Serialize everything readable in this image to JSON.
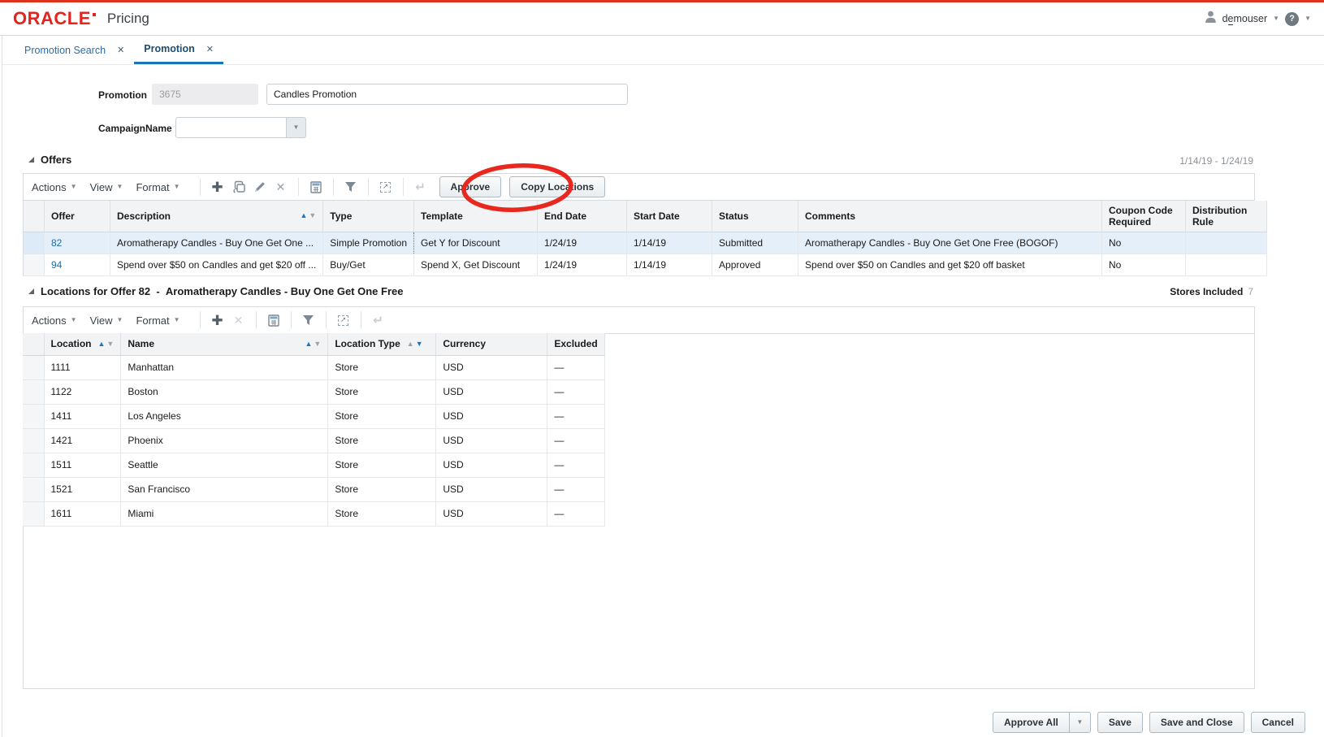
{
  "header": {
    "brand": "ORACLE",
    "app_title": "Pricing",
    "user": {
      "accel_prefix": "d",
      "accel_char": "e",
      "accel_suffix": "mouser"
    },
    "help_icon": "?",
    "icons": [
      "user-icon",
      "dropdown-caret",
      "help-icon",
      "dropdown-caret"
    ]
  },
  "tabs": [
    {
      "label": "Promotion Search",
      "active": false,
      "close_icon": "✕"
    },
    {
      "label": "Promotion",
      "active": true,
      "close_icon": "✕"
    }
  ],
  "form": {
    "promotion_label": "Promotion",
    "promotion_id": "3675",
    "promotion_name": "Candles Promotion",
    "campaign_label": "CampaignName",
    "campaign_value": ""
  },
  "offers_section": {
    "title": "Offers",
    "date_range": "1/14/19 - 1/24/19",
    "toolbar": {
      "menus": [
        "Actions",
        "View",
        "Format"
      ],
      "icons": [
        "add-icon",
        "duplicate-icon",
        "edit-icon",
        "delete-icon",
        "calculate-icon",
        "filter-icon",
        "detach-icon",
        "return-icon"
      ],
      "approve_label": "Approve",
      "copy_locations_label": "Copy Locations"
    },
    "table": {
      "columns": [
        {
          "label": ""
        },
        {
          "label": "Offer"
        },
        {
          "label": "Description",
          "sort": {
            "up": "blue",
            "down": "gray"
          }
        },
        {
          "label": "Type"
        },
        {
          "label": "Template"
        },
        {
          "label": "End Date"
        },
        {
          "label": "Start Date"
        },
        {
          "label": "Status"
        },
        {
          "label": "Comments"
        },
        {
          "label": "Coupon Code Required"
        },
        {
          "label": "Distribution Rule"
        }
      ],
      "rows": [
        [
          "",
          "82",
          "Aromatherapy Candles - Buy One Get One ...",
          "Simple Promotion",
          "Get Y for Discount",
          "1/24/19",
          "1/14/19",
          "Submitted",
          "Aromatherapy Candles - Buy One Get One Free (BOGOF)",
          "No",
          ""
        ],
        [
          "",
          "94",
          "Spend over $50 on Candles and get $20 off ...",
          "Buy/Get",
          "Spend X, Get Discount",
          "1/24/19",
          "1/14/19",
          "Approved",
          "Spend over $50 on Candles and get $20 off basket",
          "No",
          ""
        ]
      ]
    }
  },
  "locations_section": {
    "title_prefix": "Locations for Offer 82",
    "title_separator": "-",
    "title_name": "Aromatherapy Candles - Buy One Get One Free",
    "stores_included_label": "Stores Included",
    "stores_included_count": "7",
    "toolbar": {
      "menus": [
        "Actions",
        "View",
        "Format"
      ],
      "icons": [
        "add-icon",
        "delete-icon",
        "calculate-icon",
        "filter-icon",
        "detach-icon",
        "return-icon"
      ]
    },
    "table": {
      "columns": [
        {
          "label": ""
        },
        {
          "label": "Location",
          "sort": {
            "up": "blue",
            "down": "gray"
          }
        },
        {
          "label": "Name",
          "sort": {
            "up": "blue",
            "down": "gray"
          }
        },
        {
          "label": "Location Type",
          "sort": {
            "up": "gray",
            "down": "blue"
          }
        },
        {
          "label": "Currency"
        },
        {
          "label": "Excluded"
        }
      ],
      "rows": [
        [
          "",
          "1111",
          "Manhattan",
          "Store",
          "USD",
          "—"
        ],
        [
          "",
          "1122",
          "Boston",
          "Store",
          "USD",
          "—"
        ],
        [
          "",
          "1411",
          "Los Angeles",
          "Store",
          "USD",
          "—"
        ],
        [
          "",
          "1421",
          "Phoenix",
          "Store",
          "USD",
          "—"
        ],
        [
          "",
          "1511",
          "Seattle",
          "Store",
          "USD",
          "—"
        ],
        [
          "",
          "1521",
          "San Francisco",
          "Store",
          "USD",
          "—"
        ],
        [
          "",
          "1611",
          "Miami",
          "Store",
          "USD",
          "—"
        ]
      ]
    }
  },
  "footer": {
    "buttons": [
      "Approve All",
      "Save",
      "Save and Close",
      "Cancel"
    ]
  },
  "annotation": {
    "shape": "ellipse",
    "color": "#e8281e",
    "around": "Copy Locations"
  }
}
